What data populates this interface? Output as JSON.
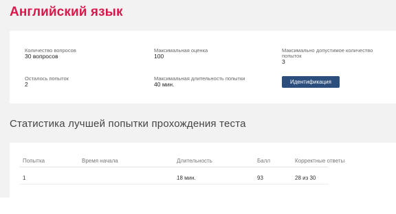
{
  "page": {
    "title": "Английский язык"
  },
  "test_info": {
    "questions": {
      "label": "Количество вопросов",
      "value": "30 вопросов"
    },
    "max_score": {
      "label": "Максимальная оценка",
      "value": "100"
    },
    "max_attempts": {
      "label": "Максимально допустимое количество попыток",
      "value": "3"
    },
    "attempts_left": {
      "label": "Осталось попыток",
      "value": "2"
    },
    "max_duration": {
      "label": "Максимальная длительность попытки",
      "value": "40 мин."
    },
    "identify_button": "Идентификация"
  },
  "stats": {
    "title": "Статистика лучшей попытки прохождения теста",
    "columns": [
      "Попытка",
      "Время начала",
      "Длительность",
      "Балл",
      "Корректные ответы"
    ],
    "rows": [
      [
        "1",
        "",
        "18 мин.",
        "93",
        "28 из 30"
      ]
    ]
  }
}
